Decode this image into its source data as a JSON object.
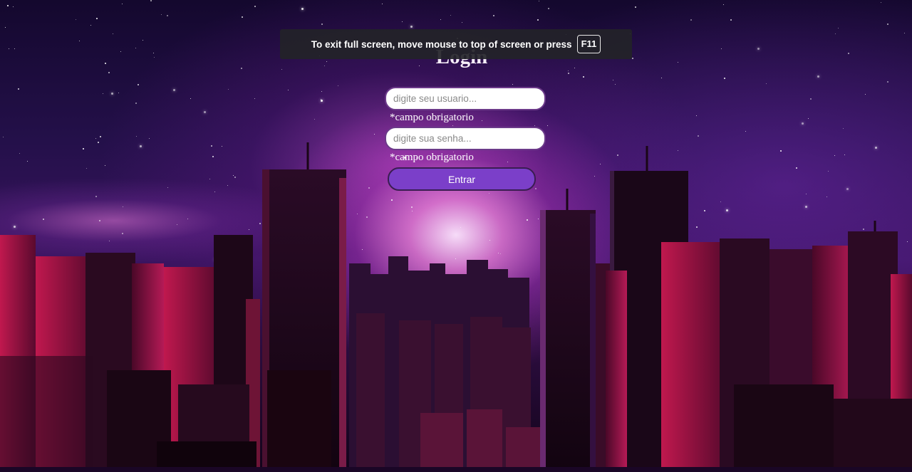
{
  "fullscreen_notice": {
    "message": "To exit full screen, move mouse to top of screen or press",
    "key": "F11"
  },
  "login": {
    "title": "Login",
    "username_placeholder": "digite seu usuario...",
    "username_required": "*campo obrigatorio",
    "password_placeholder": "digite sua senha...",
    "password_required": "*campo obrigatorio",
    "submit_label": "Entrar"
  },
  "colors": {
    "button": "#7b3fc9",
    "text": "#ffffff"
  }
}
